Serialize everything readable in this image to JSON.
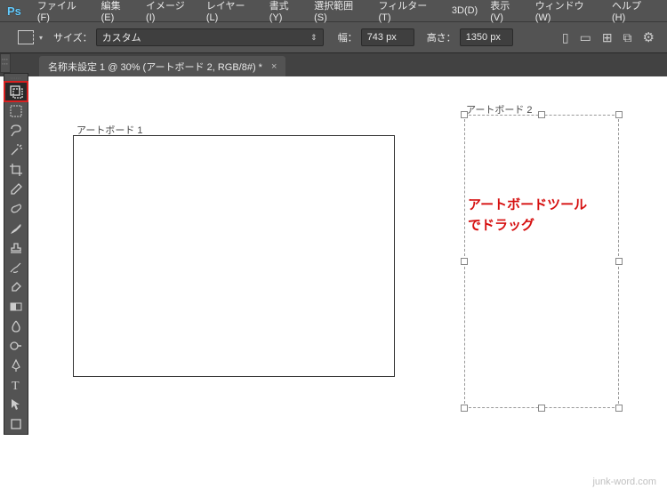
{
  "menu": {
    "items": [
      "ファイル(F)",
      "編集(E)",
      "イメージ(I)",
      "レイヤー(L)",
      "書式(Y)",
      "選択範囲(S)",
      "フィルター(T)",
      "3D(D)",
      "表示(V)",
      "ウィンドウ(W)",
      "ヘルプ(H)"
    ]
  },
  "options": {
    "size_label": "サイズ：",
    "size_value": "カスタム",
    "width_label": "幅：",
    "width_value": "743 px",
    "height_label": "高さ：",
    "height_value": "1350 px"
  },
  "tab": {
    "title": "名称未設定 1 @ 30% (アートボード 2, RGB/8#) *",
    "close": "×"
  },
  "canvas": {
    "artboard1_label": "アートボード 1",
    "artboard2_label": "アートボード 2",
    "annotation": "アートボードツール\nでドラッグ"
  },
  "watermark": "junk-word.com",
  "logo": "Ps"
}
